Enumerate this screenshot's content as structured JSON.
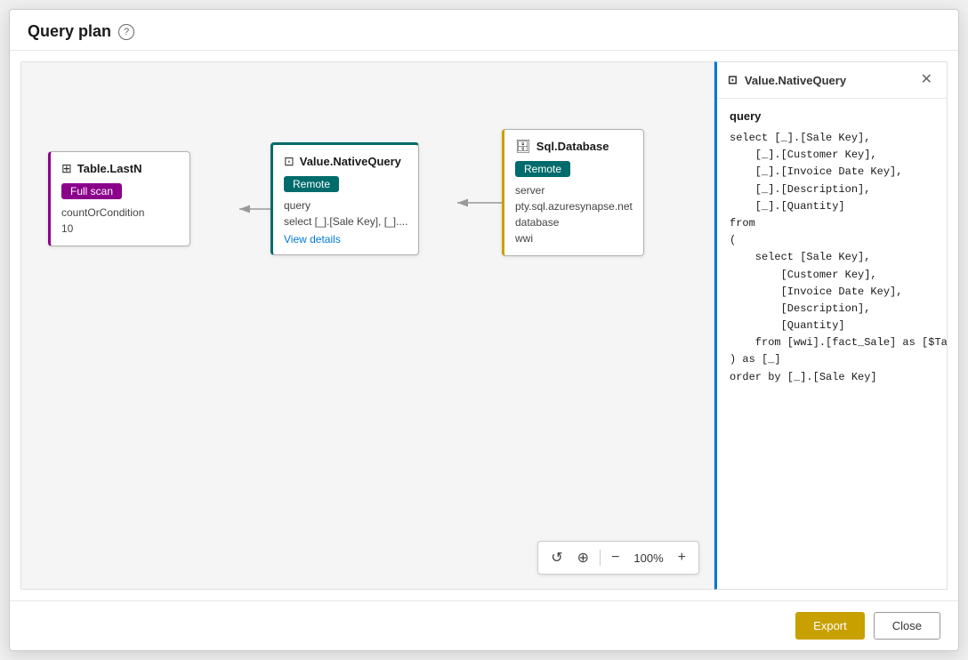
{
  "dialog": {
    "title": "Query plan",
    "help_tooltip": "Help"
  },
  "nodes": {
    "table_lastn": {
      "title": "Table.LastN",
      "badge": "Full scan",
      "badge_type": "purple",
      "prop1_key": "countOrCondition",
      "prop1_val": "10"
    },
    "value_native": {
      "title": "Value.NativeQuery",
      "badge": "Remote",
      "badge_type": "teal",
      "prop_key": "query",
      "prop_val": "select [_].[Sale Key], [_]....",
      "link_label": "View details"
    },
    "sql_database": {
      "title": "Sql.Database",
      "badge": "Remote",
      "badge_type": "teal",
      "server_label": "server",
      "server_val": "pty.sql.azuresynapse.net",
      "database_label": "database",
      "database_val": "wwi"
    }
  },
  "toolbar": {
    "undo_label": "↺",
    "select_label": "⊕",
    "zoom_out_label": "−",
    "zoom_level": "100%",
    "zoom_in_label": "+"
  },
  "side_panel": {
    "title": "Value.NativeQuery",
    "section_label": "query",
    "query_lines": [
      "select [_].[Sale Key],",
      "    [_].[Customer Key],",
      "    [_].[Invoice Date Key],",
      "    [_].[Description],",
      "    [_].[Quantity]",
      "from",
      "(",
      "    select [Sale Key],",
      "        [Customer Key],",
      "        [Invoice Date Key],",
      "        [Description],",
      "        [Quantity]",
      "    from [wwi].[fact_Sale] as [$Table]",
      ") as [_]",
      "order by [_].[Sale Key]"
    ]
  },
  "footer": {
    "export_label": "Export",
    "close_label": "Close"
  }
}
